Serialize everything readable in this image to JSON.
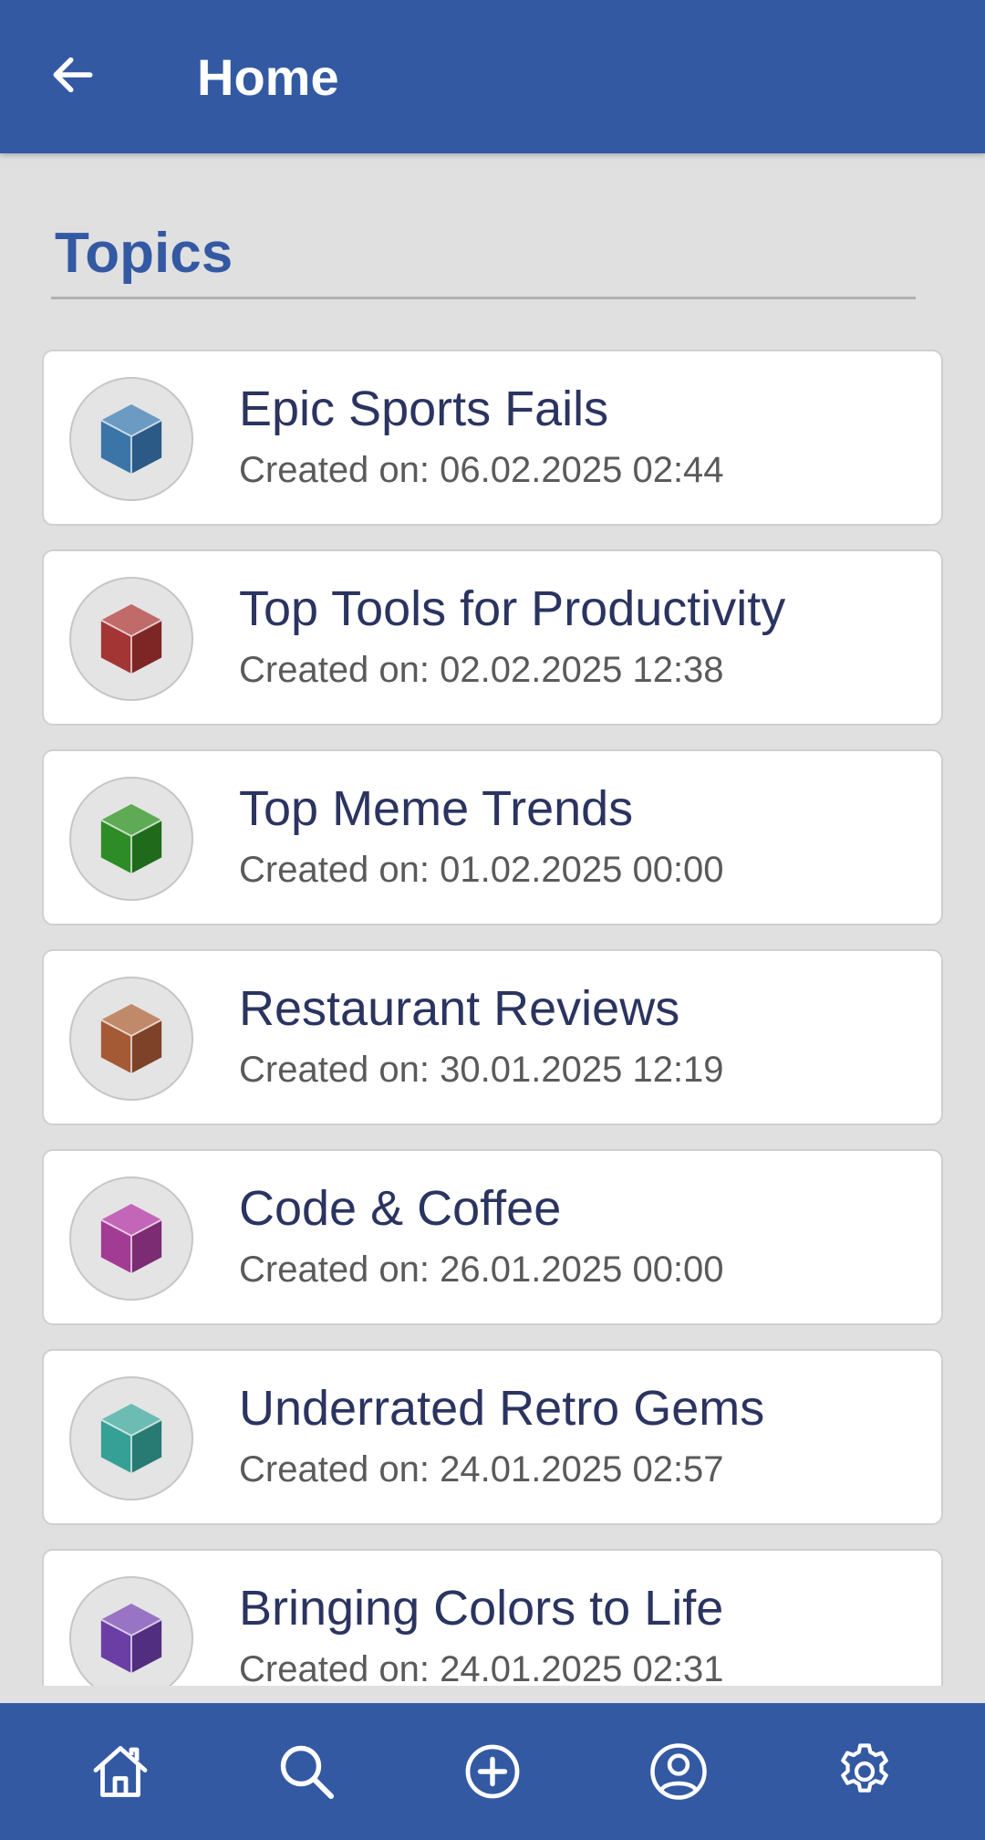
{
  "app_bar": {
    "title": "Home",
    "back_icon": "arrow-back-icon",
    "background_color": "#3459a3"
  },
  "section": {
    "title": "Topics",
    "title_color": "#3459a3"
  },
  "topics": [
    {
      "title": "Epic Sports Fails",
      "created": "Created on: 06.02.2025 02:44",
      "icon": "cube-icon",
      "color_top": "#6b9bc3",
      "color_left": "#3b75a8",
      "color_right": "#2a5a85"
    },
    {
      "title": "Top Tools for Productivity",
      "created": "Created on: 02.02.2025 12:38",
      "icon": "cube-icon",
      "color_top": "#c06a6a",
      "color_left": "#a33535",
      "color_right": "#7e2626"
    },
    {
      "title": "Top Meme Trends",
      "created": "Created on: 01.02.2025 00:00",
      "icon": "cube-icon",
      "color_top": "#5eaa55",
      "color_left": "#2e8c27",
      "color_right": "#1f6b1b"
    },
    {
      "title": "Restaurant Reviews",
      "created": "Created on: 30.01.2025 12:19",
      "icon": "cube-icon",
      "color_top": "#c08a6a",
      "color_left": "#a35a35",
      "color_right": "#7e4228"
    },
    {
      "title": "Code & Coffee",
      "created": "Created on: 26.01.2025 00:00",
      "icon": "cube-icon",
      "color_top": "#c466b8",
      "color_left": "#a23b94",
      "color_right": "#7c2c72"
    },
    {
      "title": "Underrated Retro Gems",
      "created": "Created on: 24.01.2025 02:57",
      "icon": "cube-icon",
      "color_top": "#6cbcb4",
      "color_left": "#35a096",
      "color_right": "#277b73"
    },
    {
      "title": "Bringing Colors to Life",
      "created": "Created on: 24.01.2025 02:31",
      "icon": "cube-icon",
      "color_top": "#9a74c4",
      "color_left": "#6b3ea6",
      "color_right": "#522e80"
    }
  ],
  "bottom_nav": [
    {
      "icon": "home-icon"
    },
    {
      "icon": "search-icon"
    },
    {
      "icon": "add-circle-icon"
    },
    {
      "icon": "profile-icon"
    },
    {
      "icon": "settings-icon"
    }
  ],
  "colors": {
    "primary": "#3459a3",
    "background": "#e0e0e0",
    "card_title": "#2b3460",
    "card_date": "#5a5a5a"
  }
}
